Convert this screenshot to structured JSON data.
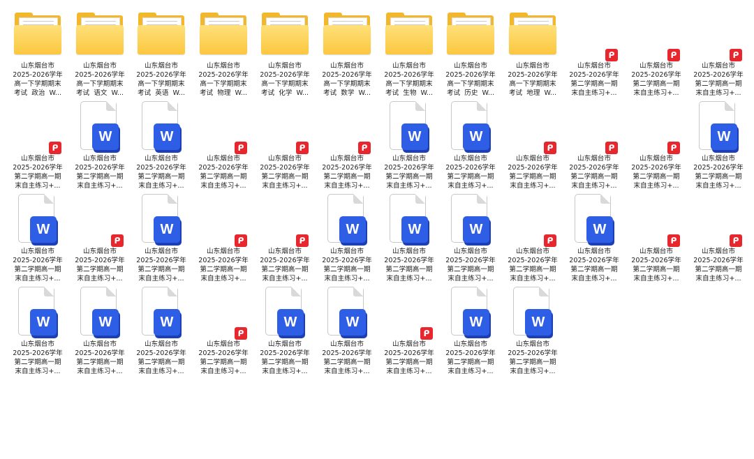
{
  "colors": {
    "folder": "#f2b72b",
    "pdf_badge": "#e8262d",
    "word": "#2f5ee6",
    "background": "#ffffff"
  },
  "icons": {
    "folder": "folder-icon",
    "pdf": "pdf-icon",
    "word": "word-icon",
    "pdf_badge_glyph": "ᑭ",
    "word_glyph": "W"
  },
  "items": [
    {
      "type": "folder",
      "label": "山东烟台市\n2025-2026学年\n高一下学期期末\n考试  政治  W..."
    },
    {
      "type": "folder",
      "label": "山东烟台市\n2025-2026学年\n高一下学期期末\n考试  语文  W..."
    },
    {
      "type": "folder",
      "label": "山东烟台市\n2025-2026学年\n高一下学期期末\n考试  英语  W..."
    },
    {
      "type": "folder",
      "label": "山东烟台市\n2025-2026学年\n高一下学期期末\n考试  物理  W..."
    },
    {
      "type": "folder",
      "label": "山东烟台市\n2025-2026学年\n高一下学期期末\n考试  化学  W..."
    },
    {
      "type": "folder",
      "label": "山东烟台市\n2025-2026学年\n高一下学期期末\n考试  数学  W..."
    },
    {
      "type": "folder",
      "label": "山东烟台市\n2025-2026学年\n高一下学期期末\n考试  生物  W..."
    },
    {
      "type": "folder",
      "label": "山东烟台市\n2025-2026学年\n高一下学期期末\n考试  历史  W..."
    },
    {
      "type": "folder",
      "label": "山东烟台市\n2025-2026学年\n高一下学期期末\n考试  地理  W..."
    },
    {
      "type": "pdf",
      "label": "山东烟台市\n2025-2026学年\n第二学期高一期\n末自主练习+..."
    },
    {
      "type": "pdf",
      "label": "山东烟台市\n2025-2026学年\n第二学期高一期\n末自主练习+..."
    },
    {
      "type": "pdf",
      "label": "山东烟台市\n2025-2026学年\n第二学期高一期\n末自主练习+..."
    },
    {
      "type": "pdf",
      "label": "山东烟台市\n2025-2026学年\n第二学期高一期\n末自主练习+..."
    },
    {
      "type": "word",
      "label": "山东烟台市\n2025-2026学年\n第二学期高一期\n末自主练习+..."
    },
    {
      "type": "word",
      "label": "山东烟台市\n2025-2026学年\n第二学期高一期\n末自主练习+..."
    },
    {
      "type": "pdf",
      "label": "山东烟台市\n2025-2026学年\n第二学期高一期\n末自主练习+..."
    },
    {
      "type": "pdf",
      "label": "山东烟台市\n2025-2026学年\n第二学期高一期\n末自主练习+..."
    },
    {
      "type": "pdf",
      "label": "山东烟台市\n2025-2026学年\n第二学期高一期\n末自主练习+..."
    },
    {
      "type": "word",
      "label": "山东烟台市\n2025-2026学年\n第二学期高一期\n末自主练习+..."
    },
    {
      "type": "word",
      "label": "山东烟台市\n2025-2026学年\n第二学期高一期\n末自主练习+..."
    },
    {
      "type": "pdf",
      "label": "山东烟台市\n2025-2026学年\n第二学期高一期\n末自主练习+..."
    },
    {
      "type": "pdf",
      "label": "山东烟台市\n2025-2026学年\n第二学期高一期\n末自主练习+..."
    },
    {
      "type": "pdf",
      "label": "山东烟台市\n2025-2026学年\n第二学期高一期\n末自主练习+..."
    },
    {
      "type": "word",
      "label": "山东烟台市\n2025-2026学年\n第二学期高一期\n末自主练习+..."
    },
    {
      "type": "word",
      "label": "山东烟台市\n2025-2026学年\n第二学期高一期\n末自主练习+..."
    },
    {
      "type": "pdf",
      "label": "山东烟台市\n2025-2026学年\n第二学期高一期\n末自主练习+..."
    },
    {
      "type": "word",
      "label": "山东烟台市\n2025-2026学年\n第二学期高一期\n末自主练习+..."
    },
    {
      "type": "pdf",
      "label": "山东烟台市\n2025-2026学年\n第二学期高一期\n末自主练习+..."
    },
    {
      "type": "pdf",
      "label": "山东烟台市\n2025-2026学年\n第二学期高一期\n末自主练习+..."
    },
    {
      "type": "word",
      "label": "山东烟台市\n2025-2026学年\n第二学期高一期\n末自主练习+..."
    },
    {
      "type": "word",
      "label": "山东烟台市\n2025-2026学年\n第二学期高一期\n末自主练习+..."
    },
    {
      "type": "word",
      "label": "山东烟台市\n2025-2026学年\n第二学期高一期\n末自主练习+..."
    },
    {
      "type": "pdf",
      "label": "山东烟台市\n2025-2026学年\n第二学期高一期\n末自主练习+..."
    },
    {
      "type": "word",
      "label": "山东烟台市\n2025-2026学年\n第二学期高一期\n末自主练习+..."
    },
    {
      "type": "pdf",
      "label": "山东烟台市\n2025-2026学年\n第二学期高一期\n末自主练习+..."
    },
    {
      "type": "pdf",
      "label": "山东烟台市\n2025-2026学年\n第二学期高一期\n末自主练习+..."
    },
    {
      "type": "word",
      "label": "山东烟台市\n2025-2026学年\n第二学期高一期\n末自主练习+..."
    },
    {
      "type": "word",
      "label": "山东烟台市\n2025-2026学年\n第二学期高一期\n末自主练习+..."
    },
    {
      "type": "word",
      "label": "山东烟台市\n2025-2026学年\n第二学期高一期\n末自主练习+..."
    },
    {
      "type": "pdf",
      "label": "山东烟台市\n2025-2026学年\n第二学期高一期\n末自主练习+..."
    },
    {
      "type": "word",
      "label": "山东烟台市\n2025-2026学年\n第二学期高一期\n末自主练习+..."
    },
    {
      "type": "word",
      "label": "山东烟台市\n2025-2026学年\n第二学期高一期\n末自主练习+..."
    },
    {
      "type": "pdf",
      "label": "山东烟台市\n2025-2026学年\n第二学期高一期\n末自主练习+..."
    },
    {
      "type": "word",
      "label": "山东烟台市\n2025-2026学年\n第二学期高一期\n末自主练习+..."
    },
    {
      "type": "word",
      "label": "山东烟台市\n2025-2026学年\n第二学期高一期\n末自主练习+..."
    }
  ]
}
